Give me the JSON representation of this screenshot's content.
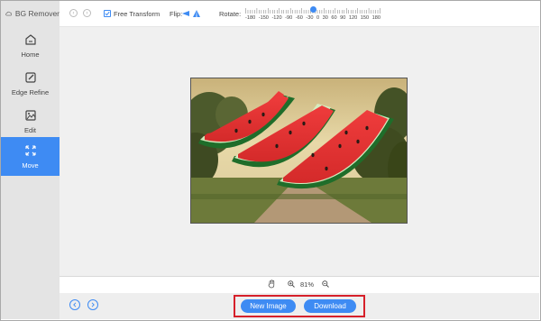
{
  "app": {
    "title": "BG Remover"
  },
  "sidebar": {
    "items": [
      {
        "label": "Home",
        "icon": "home-icon"
      },
      {
        "label": "Edge Refine",
        "icon": "edge-refine-icon"
      },
      {
        "label": "Edit",
        "icon": "image-edit-icon"
      },
      {
        "label": "Move",
        "icon": "move-icon",
        "active": true
      }
    ]
  },
  "toolbar": {
    "free_transform_label": "Free Transform",
    "free_transform_checked": true,
    "flip_label": "Flip:",
    "rotate_label": "Rotate:",
    "rotate_ticks": [
      "-180",
      "-150",
      "-120",
      "-90",
      "-60",
      "-30",
      "0",
      "30",
      "60",
      "90",
      "120",
      "150",
      "180"
    ],
    "rotate_value": 0
  },
  "zoom": {
    "level": "81%"
  },
  "actions": {
    "new_image_label": "New Image",
    "download_label": "Download"
  },
  "colors": {
    "accent": "#3e8bf3",
    "highlight_outline": "#d6202a",
    "sidebar_bg": "#e4e4e4",
    "canvas_bg": "#f0f0f0"
  }
}
